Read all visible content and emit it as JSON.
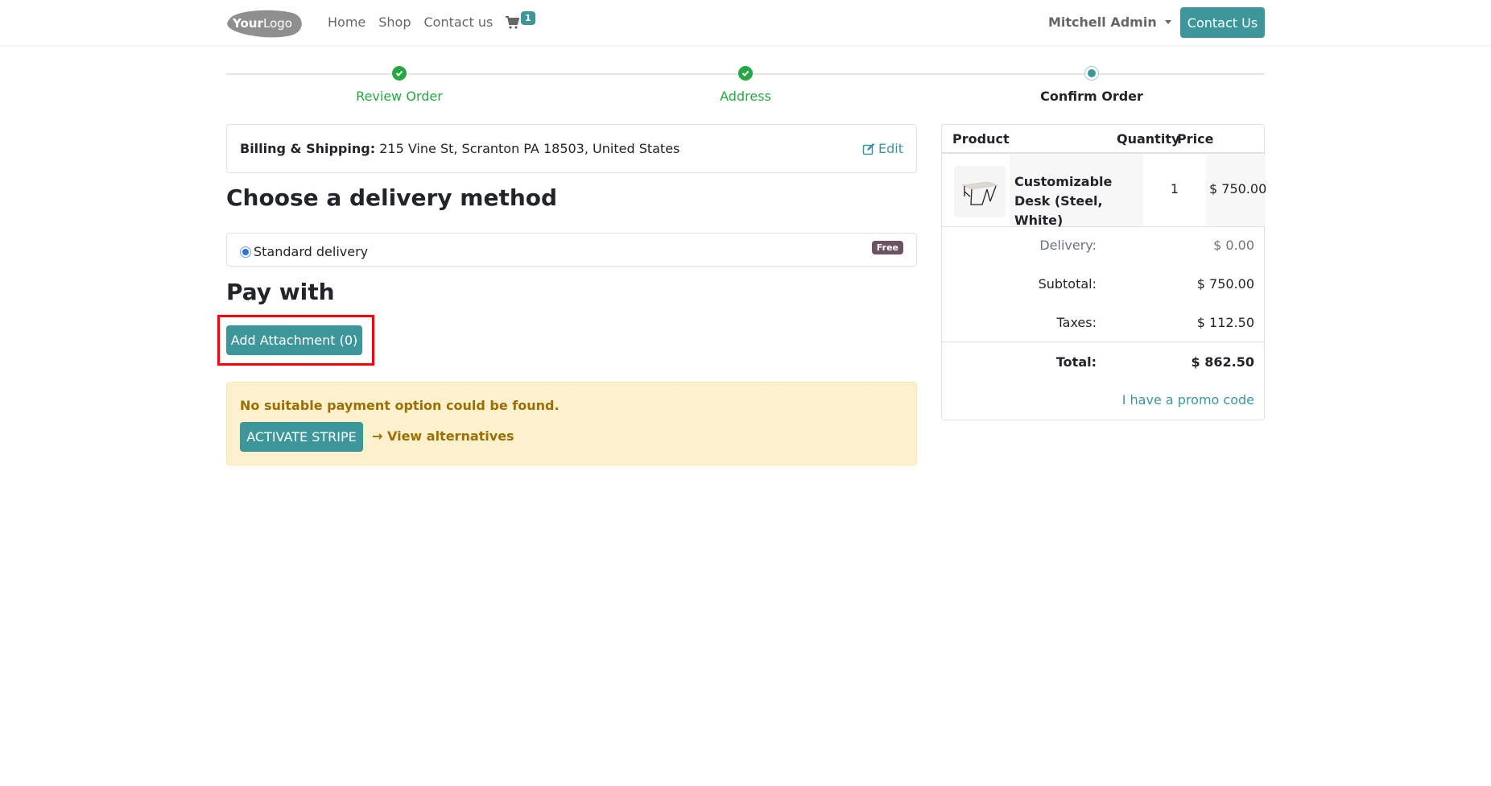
{
  "navbar": {
    "logo_text": "YourLogo",
    "links": [
      "Home",
      "Shop",
      "Contact us"
    ],
    "cart_count": "1",
    "user_name": "Mitchell Admin",
    "contact_button": "Contact Us"
  },
  "wizard": {
    "steps": [
      {
        "label": "Review Order",
        "state": "done"
      },
      {
        "label": "Address",
        "state": "done"
      },
      {
        "label": "Confirm Order",
        "state": "current"
      }
    ]
  },
  "address": {
    "label": "Billing & Shipping:",
    "value": "215 Vine St, Scranton PA 18503, United States",
    "edit_label": "Edit"
  },
  "delivery": {
    "heading": "Choose a delivery method",
    "options": [
      {
        "label": "Standard delivery",
        "selected": true,
        "badge": "Free"
      }
    ]
  },
  "payment": {
    "heading": "Pay with",
    "attach_button": "Add Attachment (0)",
    "alert_message": "No suitable payment option could be found.",
    "activate_button": "ACTIVATE STRIPE",
    "alternatives_link": "→ View alternatives"
  },
  "order": {
    "headers": {
      "product": "Product",
      "quantity": "Quantity",
      "price": "Price"
    },
    "items": [
      {
        "name": "Customizable Desk (Steel, White)",
        "quantity": "1",
        "price": "$ 750.00",
        "image_icon": "desk-image"
      }
    ],
    "summary": {
      "delivery_label": "Delivery:",
      "delivery_value": "$ 0.00",
      "subtotal_label": "Subtotal:",
      "subtotal_value": "$ 750.00",
      "taxes_label": "Taxes:",
      "taxes_value": "$ 112.50",
      "total_label": "Total:",
      "total_value": "$ 862.50"
    },
    "promo_link": "I have a promo code"
  },
  "colors": {
    "primary": "#3d969a",
    "success": "#28a745",
    "warning_text": "#9b6f00",
    "warning_bg": "#fcf1cc",
    "highlight": "#ff0000",
    "editor_corner": "#6d4a6a"
  }
}
